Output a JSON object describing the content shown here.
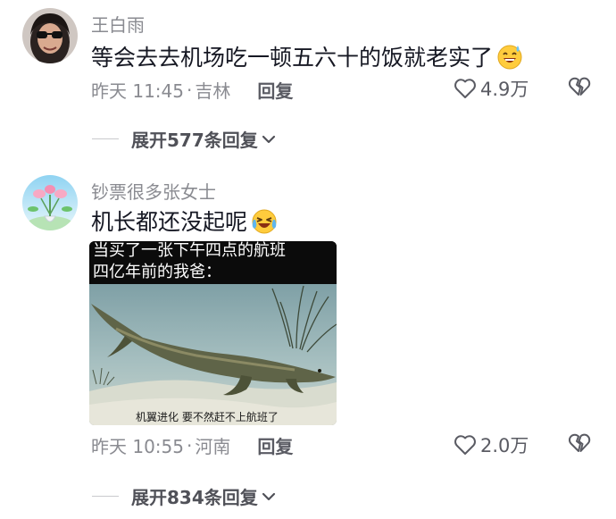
{
  "comments": [
    {
      "username": "王白雨",
      "text": "等会去去机场吃一顿五六十的饭就老实了",
      "emoji": "sweat-smile-emoji",
      "time": "昨天 11:45",
      "separator": "·",
      "location": "吉林",
      "reply_label": "回复",
      "likes": "4.9万",
      "expand_label": "展开577条回复"
    },
    {
      "username": "钞票很多张女士",
      "text": "机长都还没起呢",
      "emoji": "crying-laughing-emoji",
      "time": "昨天 10:55",
      "separator": "·",
      "location": "河南",
      "reply_label": "回复",
      "likes": "2.0万",
      "expand_label": "展开834条回复",
      "image": {
        "caption_top_line1": "当买了一张下午四点的航班",
        "caption_top_line2": "四亿年前的我爸：",
        "caption_bottom": "机翼进化 要不然赶不上航班了"
      }
    }
  ],
  "colors": {
    "text": "#161823",
    "secondary": "#8a8b91",
    "action": "#5a5b63"
  }
}
